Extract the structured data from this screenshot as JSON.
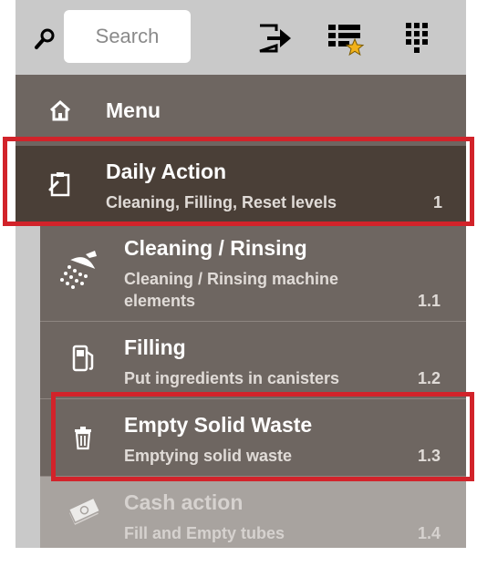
{
  "toolbar": {
    "search_placeholder": "Search",
    "icons": [
      "search-icon",
      "logout-icon",
      "favorites-list-icon",
      "keypad-icon"
    ]
  },
  "menu": {
    "header": {
      "label": "Menu",
      "icon": "home-icon"
    },
    "daily": {
      "title": "Daily Action",
      "subtitle": "Cleaning, Filling, Reset levels",
      "number": "1",
      "icon": "clipboard-icon"
    },
    "items": [
      {
        "title": "Cleaning / Rinsing",
        "subtitle_line1": "Cleaning / Rinsing machine",
        "subtitle_line2": "elements",
        "number": "1.1",
        "icon": "shower-icon"
      },
      {
        "title": "Filling",
        "subtitle": "Put ingredients in canisters",
        "number": "1.2",
        "icon": "fuel-icon"
      },
      {
        "title": "Empty Solid Waste",
        "subtitle": "Emptying solid waste",
        "number": "1.3",
        "icon": "trash-icon"
      },
      {
        "title": "Cash action",
        "subtitle": "Fill and Empty tubes",
        "number": "1.4",
        "icon": "cash-icon"
      }
    ]
  },
  "colors": {
    "highlight": "#d2232a",
    "toolbar_bg": "#c9c9c9",
    "menu_bg": "#6e6661",
    "selected_bg": "#4a3f37"
  }
}
